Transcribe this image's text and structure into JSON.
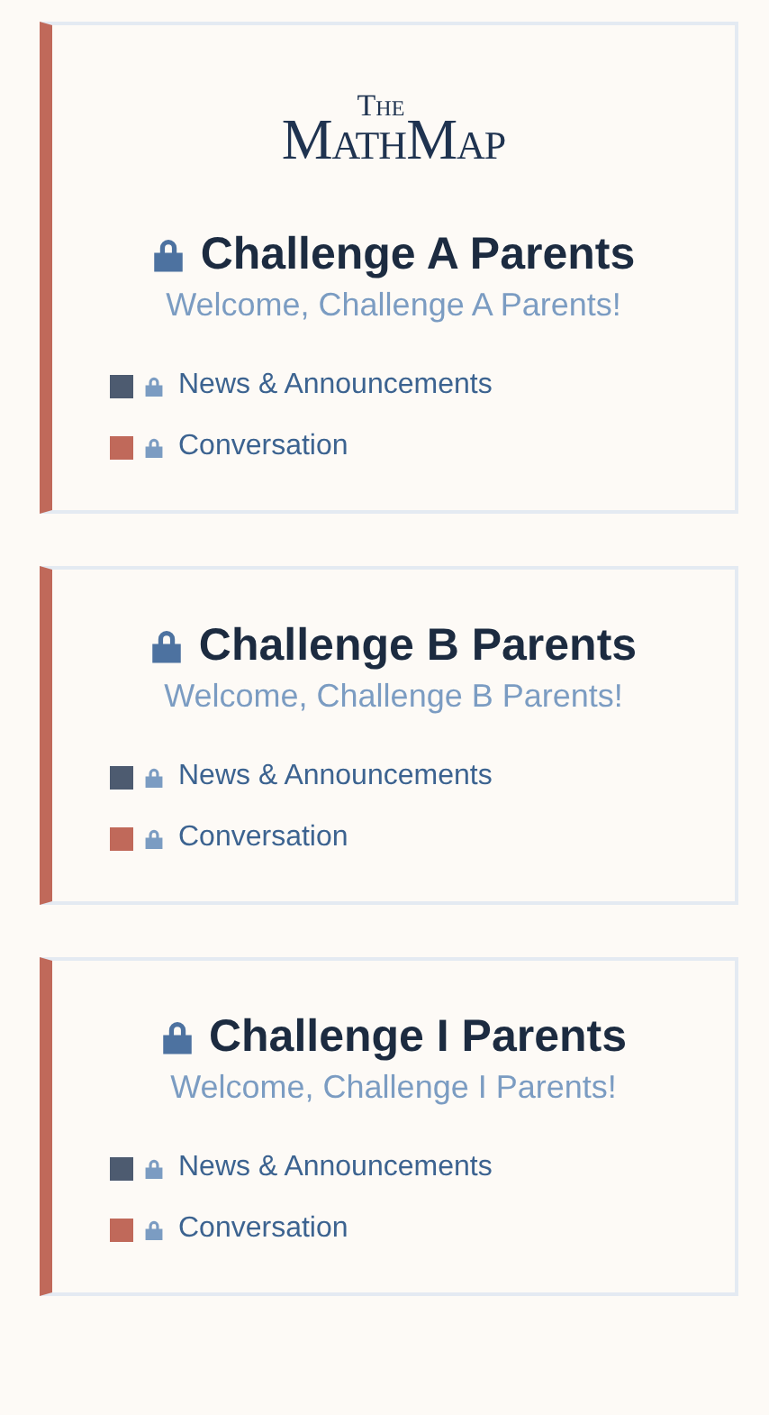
{
  "groups": [
    {
      "logo": {
        "top": "The",
        "main": "MathMap"
      },
      "title": "Challenge A Parents",
      "welcome": "Welcome, Challenge A Parents!",
      "channels": [
        {
          "name": "News & Announcements",
          "color": "#4d5b70"
        },
        {
          "name": "Conversation",
          "color": "#c0695a"
        }
      ]
    },
    {
      "title": "Challenge B Parents",
      "welcome": "Welcome, Challenge B Parents!",
      "channels": [
        {
          "name": "News & Announcements",
          "color": "#4d5b70"
        },
        {
          "name": "Conversation",
          "color": "#c0695a"
        }
      ]
    },
    {
      "title": "Challenge I Parents",
      "welcome": "Welcome, Challenge I Parents!",
      "channels": [
        {
          "name": "News & Announcements",
          "color": "#4d5b70"
        },
        {
          "name": "Conversation",
          "color": "#c0695a"
        }
      ]
    }
  ]
}
